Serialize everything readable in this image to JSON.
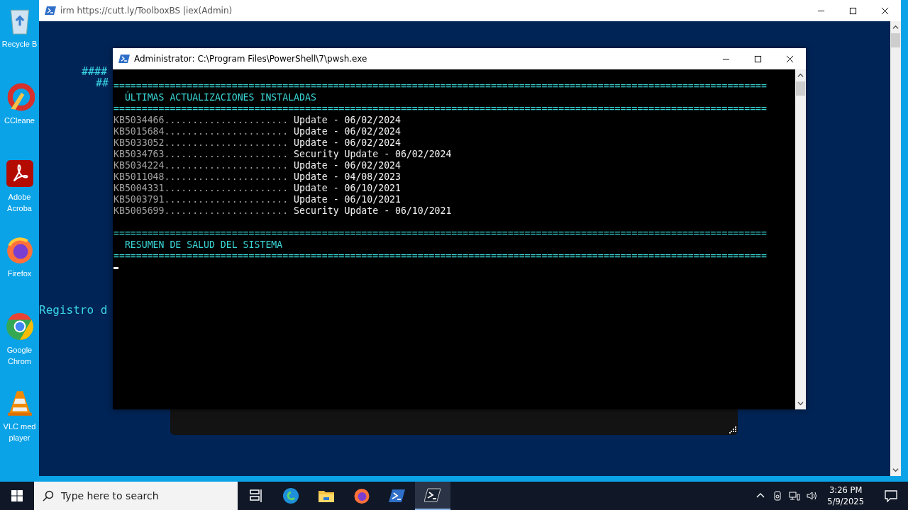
{
  "desktop_icons": [
    {
      "kind": "recycle",
      "lines": [
        "Recycle B"
      ]
    },
    {
      "kind": "ccleaner",
      "lines": [
        "CCleane"
      ]
    },
    {
      "kind": "acrobat",
      "lines": [
        "Adobe",
        "Acroba"
      ]
    },
    {
      "kind": "firefox",
      "lines": [
        "Firefox"
      ]
    },
    {
      "kind": "chrome",
      "lines": [
        "Google",
        "Chrom"
      ]
    },
    {
      "kind": "vlc",
      "lines": [
        "VLC med",
        "player"
      ]
    }
  ],
  "back_window": {
    "title": "irm https://cutt.ly/ToolboxBS |iex(Admin)",
    "fragments": [
      "####",
      "##"
    ],
    "registro": "Registro d"
  },
  "front_window": {
    "title": "Administrator: C:\\Program Files\\PowerShell\\7\\pwsh.exe",
    "lines": [
      {
        "kind": "blank"
      },
      {
        "kind": "separator",
        "text": "===================================================================================================================="
      },
      {
        "kind": "heading",
        "text": "ÚLTIMAS ACTUALIZACIONES INSTALADAS"
      },
      {
        "kind": "separator",
        "text": "===================================================================================================================="
      },
      {
        "kind": "entry",
        "kb": "KB5034466",
        "dots": "......................",
        "description": "Update - 06/02/2024"
      },
      {
        "kind": "entry",
        "kb": "KB5015684",
        "dots": "......................",
        "description": "Update - 06/02/2024"
      },
      {
        "kind": "entry",
        "kb": "KB5033052",
        "dots": "......................",
        "description": "Update - 06/02/2024"
      },
      {
        "kind": "entry",
        "kb": "KB5034763",
        "dots": "......................",
        "description": "Security Update - 06/02/2024"
      },
      {
        "kind": "entry",
        "kb": "KB5034224",
        "dots": "......................",
        "description": "Update - 06/02/2024"
      },
      {
        "kind": "entry",
        "kb": "KB5011048",
        "dots": "......................",
        "description": "Update - 04/08/2023"
      },
      {
        "kind": "entry",
        "kb": "KB5004331",
        "dots": "......................",
        "description": "Update - 06/10/2021"
      },
      {
        "kind": "entry",
        "kb": "KB5003791",
        "dots": "......................",
        "description": "Update - 06/10/2021"
      },
      {
        "kind": "entry",
        "kb": "KB5005699",
        "dots": "......................",
        "description": "Security Update - 06/10/2021"
      },
      {
        "kind": "blank"
      },
      {
        "kind": "separator",
        "text": "===================================================================================================================="
      },
      {
        "kind": "heading",
        "text": "RESUMEN DE SALUD DEL SISTEMA"
      },
      {
        "kind": "separator",
        "text": "===================================================================================================================="
      },
      {
        "kind": "cursor"
      }
    ]
  },
  "taskbar": {
    "search_placeholder": "Type here to search",
    "apps": [
      {
        "kind": "taskview",
        "selected": false
      },
      {
        "kind": "edge",
        "selected": false
      },
      {
        "kind": "explorer",
        "selected": false
      },
      {
        "kind": "firefox",
        "selected": false
      },
      {
        "kind": "powershell",
        "selected": false
      },
      {
        "kind": "terminal",
        "selected": true
      }
    ],
    "time": "3:26 PM",
    "date": "5/9/2025"
  }
}
